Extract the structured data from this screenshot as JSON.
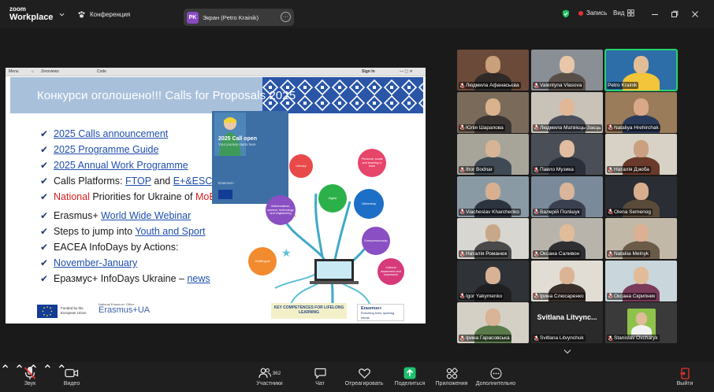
{
  "app": {
    "logo_line1": "zoom",
    "logo_line2": "Workplace",
    "meeting_label": "Конференция"
  },
  "share_pill": {
    "initials": "PK",
    "label": "Экран (Petro Krainik)"
  },
  "top_right": {
    "recording": "Запись",
    "view": "Вид"
  },
  "browser": {
    "tab1": "Menu",
    "tab2": "Zeroviews",
    "tab3": "Code",
    "signin": "Sign In"
  },
  "slide": {
    "title": "Конкурси оголошено!!! Calls for Proposals 2025",
    "bullets": [
      {
        "text": "2025 Calls announcement"
      },
      {
        "text": "2025 Programme Guide"
      },
      {
        "text": "2025 Annual Work Programme"
      },
      {
        "prefix": "Calls Platforms: ",
        "link1": "FTOP",
        "mid": " and ",
        "link2": "E+&ESC"
      },
      {
        "red": "National",
        "rest": " Priorities for Ukraine of ",
        "red2": "MoESU!!!"
      },
      {
        "prefix": "Erasmus+ ",
        "link": "World Wide Webinar"
      },
      {
        "prefix": "Steps to jump into ",
        "link": "Youth and Sport"
      },
      {
        "text": "EACEA InfoDays by Actions:"
      },
      {
        "link": "November-January"
      },
      {
        "prefix": "Еразмус+ InfoDays Ukraine – ",
        "link": "news"
      }
    ],
    "cover": {
      "headline": "2025 Call open",
      "sub": "Your journey starts here",
      "brand": "Erasmus+"
    },
    "circles": [
      "Literacy",
      "Personal, social and learning to learn",
      "Digital",
      "Citizenship",
      "Mathematical, science, technology and engineering",
      "Entrepreneurship",
      "Multilingual",
      "Cultural awareness and expression"
    ],
    "key_competences": "KEY COMPETENCES FOR LIFELONG LEARNING",
    "erasmus_badge": "Erasmus+",
    "erasmus_badge_sub": "Enriching lives, opening minds",
    "eu_text": "Funded by the European Union",
    "office_small": "National Erasmus+ Office",
    "office_main": "Erasmus+UA"
  },
  "participants": [
    {
      "name": "Людмила Афанасьєва",
      "muted": true
    },
    {
      "name": "Valentyna Vlasova",
      "muted": true
    },
    {
      "name": "Petro Krainik",
      "muted": false,
      "speaking": true
    },
    {
      "name": "Юлія Шарапова",
      "muted": true
    },
    {
      "name": "Людмила Матвієць-Заєць",
      "muted": true
    },
    {
      "name": "Nataliya Hrehirchak",
      "muted": true
    },
    {
      "name": "Ihor Bodnar",
      "muted": true
    },
    {
      "name": "Павло Музика",
      "muted": true
    },
    {
      "name": "Наталія Дзюба",
      "muted": true
    },
    {
      "name": "Viacheslav Kharchenko",
      "muted": true
    },
    {
      "name": "Валерій Полішук",
      "muted": true
    },
    {
      "name": "Olena Semenog",
      "muted": true
    },
    {
      "name": "Наталія Романюк",
      "muted": true
    },
    {
      "name": "Оксана Саливон",
      "muted": true
    },
    {
      "name": "Nataliia Melnyk",
      "muted": true
    },
    {
      "name": "Igor Yakymenko",
      "muted": true
    },
    {
      "name": "Ірина Слюсаренко",
      "muted": true
    },
    {
      "name": "Оксана Скрипник",
      "muted": true
    },
    {
      "name": "Ірина Гарасовська",
      "muted": true
    },
    {
      "name": "Svitlana Litvynchuk",
      "muted": true,
      "big_name": "Svitlana Litvync..."
    },
    {
      "name": "Stanislav Ovcharyk",
      "muted": true
    }
  ],
  "toolbar": {
    "audio": "Звук",
    "video": "Видео",
    "participants": "Участники",
    "participants_count": "362",
    "chat": "Чат",
    "react": "Отреагировать",
    "share": "Поделиться",
    "apps": "Приложения",
    "more": "Дополнительно",
    "leave": "Выйти"
  },
  "colors": {
    "accent_green": "#22d66e",
    "record_red": "#e03030",
    "share_green": "#1fc16b"
  }
}
